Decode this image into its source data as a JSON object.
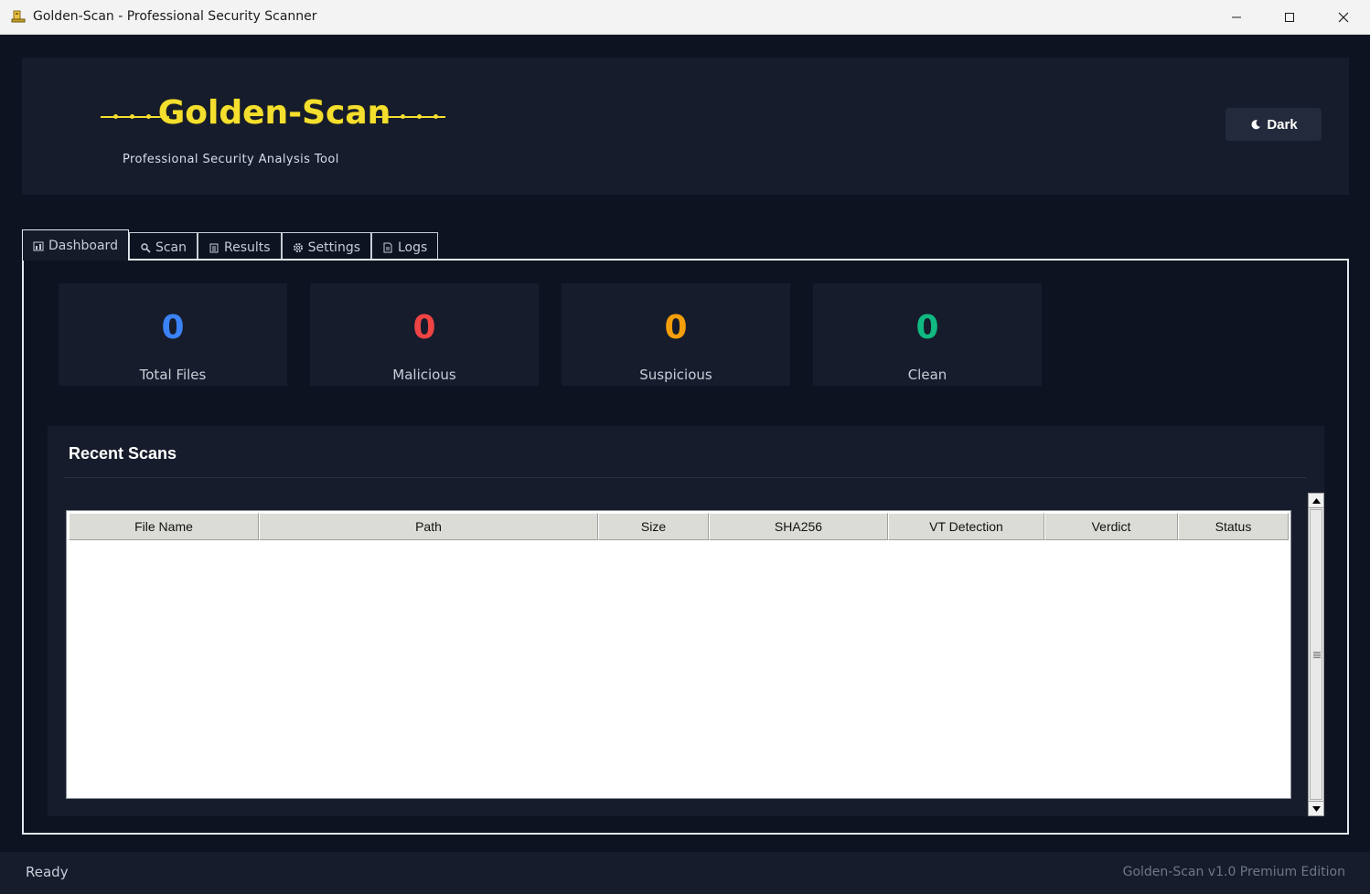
{
  "window": {
    "title": "Golden-Scan - Professional Security Scanner",
    "controls": [
      "minimize",
      "maximize",
      "close"
    ]
  },
  "header": {
    "logo_title": "Golden-Scan",
    "subtitle": "Professional Security Analysis Tool",
    "theme_button_label": "Dark",
    "theme_button_icon": "moon-icon",
    "accent_color": "#f5df2e"
  },
  "tabs": [
    {
      "label": "Dashboard",
      "icon": "dashboard-icon",
      "active": true
    },
    {
      "label": "Scan",
      "icon": "magnifier-icon",
      "active": false
    },
    {
      "label": "Results",
      "icon": "clipboard-icon",
      "active": false
    },
    {
      "label": "Settings",
      "icon": "gear-icon",
      "active": false
    },
    {
      "label": "Logs",
      "icon": "document-icon",
      "active": false
    }
  ],
  "stats": [
    {
      "value": "0",
      "label": "Total Files",
      "color": "#3b82f6"
    },
    {
      "value": "0",
      "label": "Malicious",
      "color": "#ef4444"
    },
    {
      "value": "0",
      "label": "Suspicious",
      "color": "#f59e0b"
    },
    {
      "value": "0",
      "label": "Clean",
      "color": "#10b981"
    }
  ],
  "recent_scans": {
    "title": "Recent Scans",
    "columns": [
      "File Name",
      "Path",
      "Size",
      "SHA256",
      "VT Detection",
      "Verdict",
      "Status"
    ],
    "rows": []
  },
  "statusbar": {
    "status": "Ready",
    "edition": "Golden-Scan v1.0 Premium Edition"
  }
}
